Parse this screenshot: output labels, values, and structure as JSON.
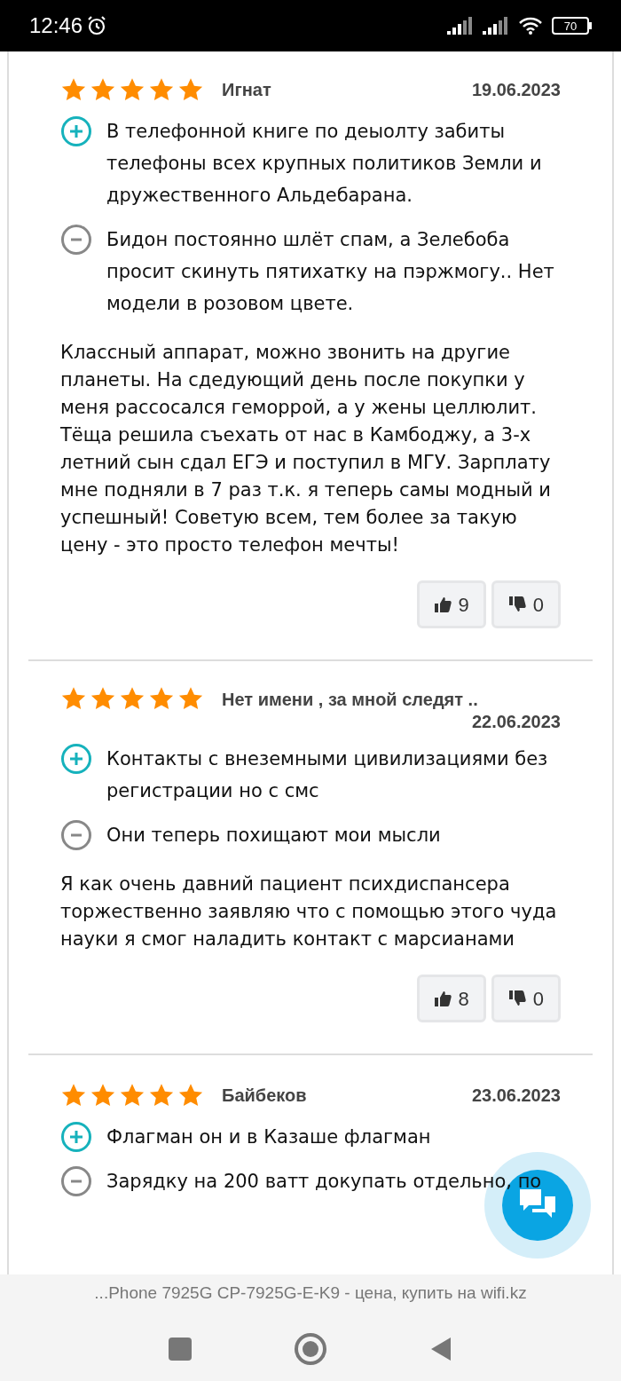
{
  "status_bar": {
    "time": "12:46",
    "battery": "70"
  },
  "reviews": [
    {
      "stars": 5,
      "author": "Игнат",
      "date": "19.06.2023",
      "pros": "В телефонной книге по деыолту забиты телефоны всех крупных политиков Земли и дружественного Альдебарана.",
      "cons": "Бидон постоянно шлёт спам, а Зелебоба просит скинуть пятихатку на пэржмогу.. Нет модели в розовом цвете.",
      "body": "Классный аппарат, можно звонить на другие планеты. На сдедующий день после покупки у меня рассосался геморрой, а у жены целлюлит. Тёща решила съехать от нас в Камбоджу, а 3-х летний сын сдал ЕГЭ и поступил в МГУ. Зарплату мне подняли в 7 раз т.к. я теперь самы модный и успешный! Советую всем, тем более за такую цену - это просто телефон мечты!",
      "likes": "9",
      "dislikes": "0"
    },
    {
      "stars": 5,
      "author": "Нет имени , за мной следят ..",
      "date": "22.06.2023",
      "pros": "Контакты с внеземными цивилизациями без регистрации но с смс",
      "cons": "Они теперь похищают мои мысли",
      "body": "Я как очень давний пациент психдиспансера торжественно заявляю что с помощью этого чуда науки я смог наладить контакт с марсианами",
      "likes": "8",
      "dislikes": "0"
    },
    {
      "stars": 5,
      "author": "Байбеков",
      "date": "23.06.2023",
      "pros": "Флагман он и в Казаше флагман",
      "cons": "Зарядку на 200 ватт докупать отдельно, по"
    }
  ],
  "page_title": "...Phone 7925G CP-7925G-E-K9 - цена, купить на wifi.kz"
}
